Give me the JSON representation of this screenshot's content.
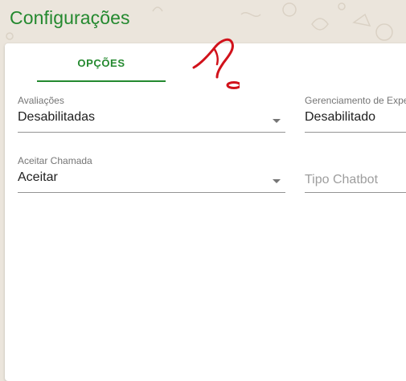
{
  "page": {
    "title": "Configurações"
  },
  "tabs": [
    {
      "label": "OPÇÕES",
      "active": true
    }
  ],
  "fields": {
    "avaliacoes": {
      "label": "Avaliações",
      "value": "Desabilitadas"
    },
    "gerenciamento": {
      "label": "Gerenciamento de Expe",
      "value": "Desabilitado"
    },
    "aceitar_chamada": {
      "label": "Aceitar Chamada",
      "value": "Aceitar"
    },
    "tipo_chatbot": {
      "placeholder": "Tipo Chatbot"
    }
  },
  "colors": {
    "accent": "#24892f",
    "annotation": "#d1121b",
    "background": "#ebe5dc"
  },
  "icons": {
    "dropdown": "caret-down-icon",
    "annotation": "question-mark-scribble"
  }
}
